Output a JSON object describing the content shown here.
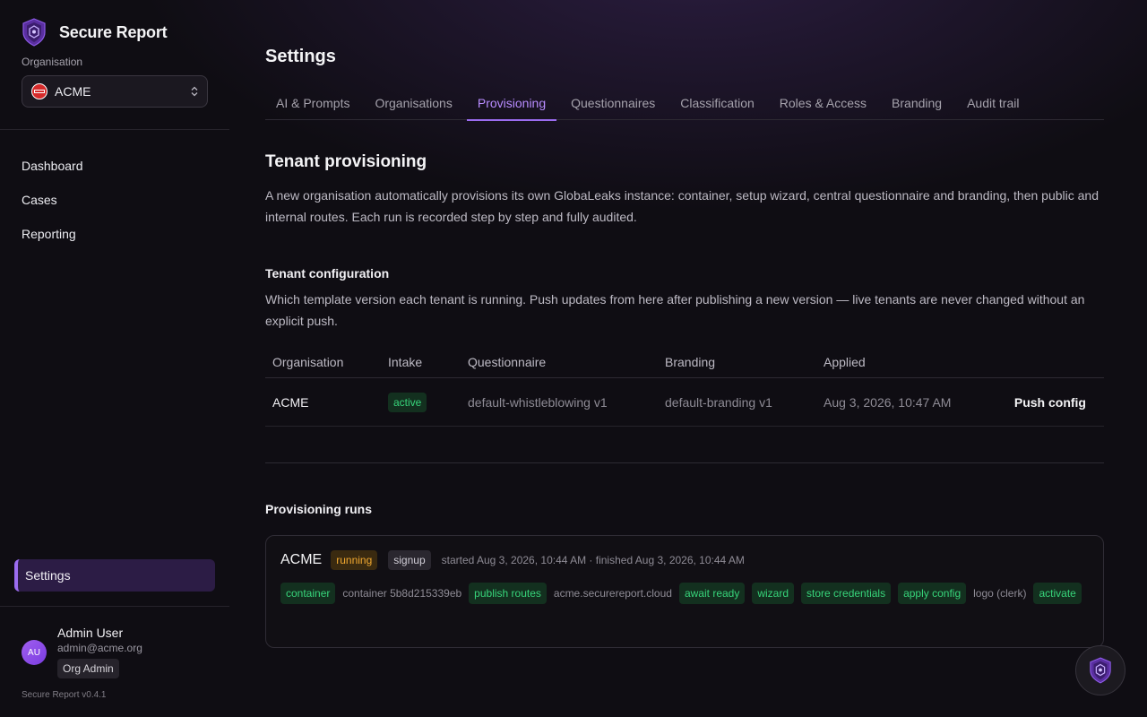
{
  "brand": {
    "name": "Secure Report"
  },
  "sidebar": {
    "org_label": "Organisation",
    "org_selected": "ACME",
    "org_badge_text": "ACME",
    "nav": [
      {
        "label": "Dashboard"
      },
      {
        "label": "Cases"
      },
      {
        "label": "Reporting"
      }
    ],
    "settings_label": "Settings",
    "user": {
      "initials": "AU",
      "name": "Admin User",
      "email": "admin@acme.org",
      "role": "Org Admin"
    },
    "version": "Secure Report v0.4.1"
  },
  "main": {
    "title": "Settings",
    "tabs": [
      {
        "label": "AI & Prompts"
      },
      {
        "label": "Organisations"
      },
      {
        "label": "Provisioning",
        "active": true
      },
      {
        "label": "Questionnaires"
      },
      {
        "label": "Classification"
      },
      {
        "label": "Roles & Access"
      },
      {
        "label": "Branding"
      },
      {
        "label": "Audit trail"
      }
    ],
    "section_title": "Tenant provisioning",
    "section_desc": "A new organisation automatically provisions its own GlobaLeaks instance: container, setup wizard, central questionnaire and branding, then public and internal routes. Each run is recorded step by step and fully audited.",
    "config_title": "Tenant configuration",
    "config_desc": "Which template version each tenant is running. Push updates from here after publishing a new version — live tenants are never changed without an explicit push.",
    "table": {
      "headers": [
        "Organisation",
        "Intake",
        "Questionnaire",
        "Branding",
        "Applied"
      ],
      "rows": [
        {
          "organisation": "ACME",
          "intake": "active",
          "questionnaire": "default-whistleblowing v1",
          "branding": "default-branding v1",
          "applied": "Aug 3, 2026, 10:47 AM",
          "action": "Push config"
        }
      ]
    },
    "runs_title": "Provisioning runs",
    "run": {
      "org": "ACME",
      "status": "running",
      "trigger": "signup",
      "meta": "started Aug 3, 2026, 10:44 AM · finished Aug 3, 2026, 10:44 AM",
      "steps": {
        "container": "container",
        "container_detail": "container 5b8d215339eb",
        "publish_routes": "publish routes",
        "routes_detail": "acme.securereport.cloud",
        "await_ready": "await ready",
        "wizard": "wizard",
        "store_credentials": "store credentials",
        "apply_config": "apply config",
        "config_detail": "logo (clerk)",
        "activate": "activate"
      }
    }
  },
  "colors": {
    "accent": "#9b6cf0",
    "success": "#37d47a",
    "warning": "#f0a830",
    "background": "#0f0d13"
  }
}
